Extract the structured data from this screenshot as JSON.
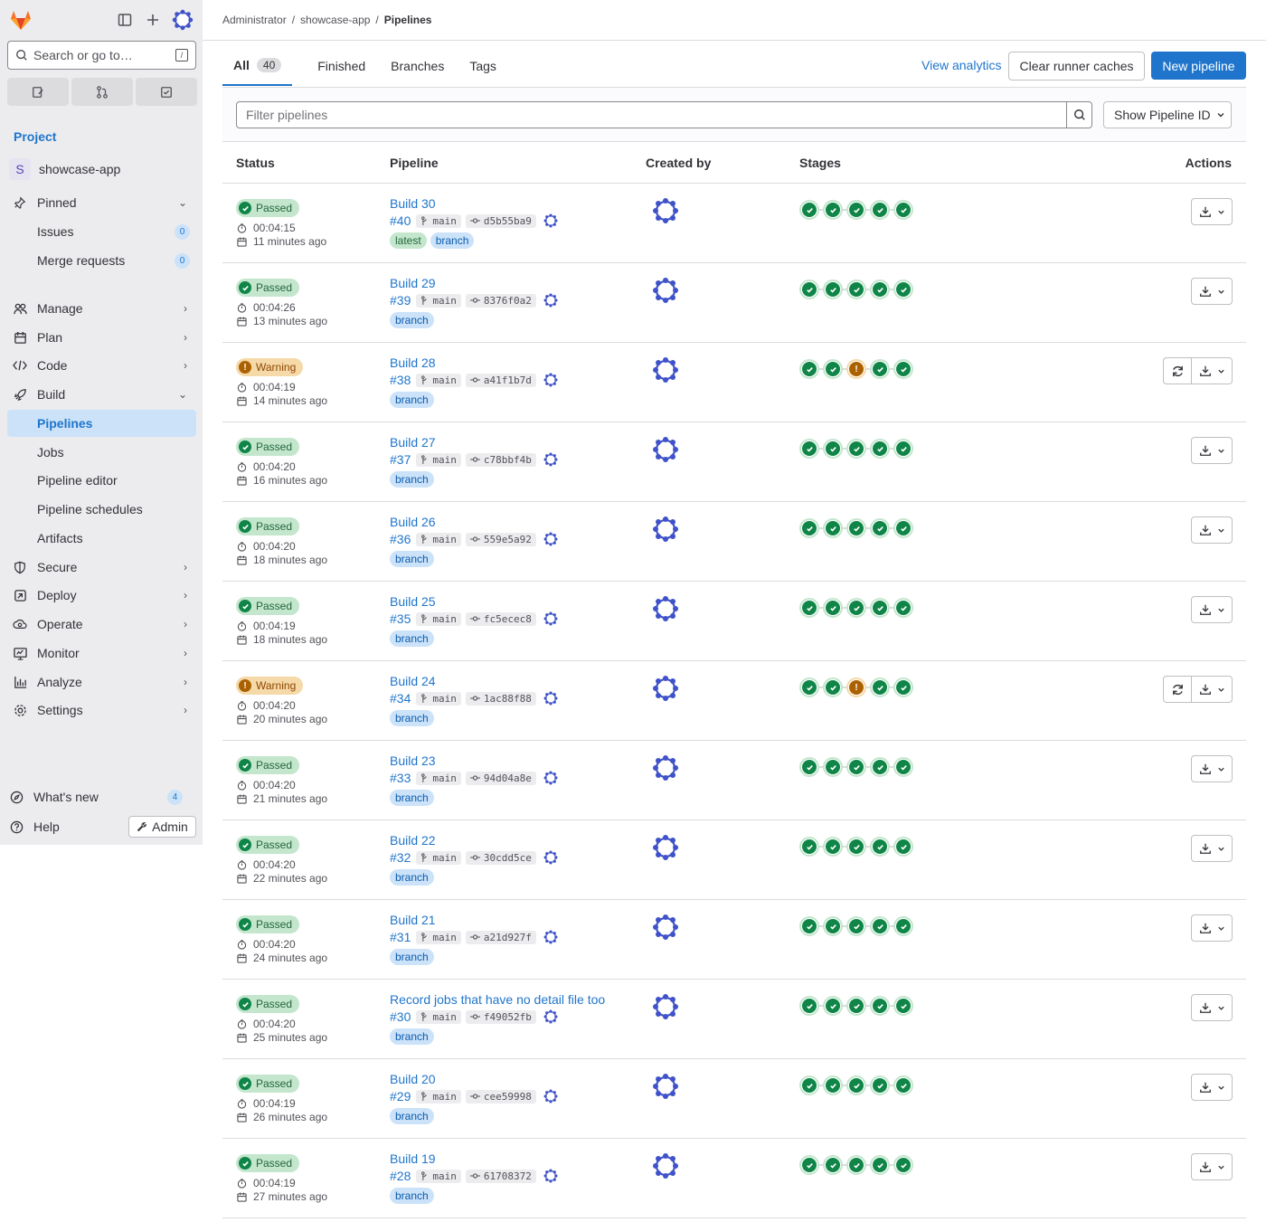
{
  "sidebar": {
    "search_placeholder": "Search or go to…",
    "search_shortcut": "/",
    "section_label": "Project",
    "project": {
      "avatar_letter": "S",
      "name": "showcase-app"
    },
    "pinned": {
      "label": "Pinned",
      "items": [
        {
          "label": "Issues",
          "count": "0"
        },
        {
          "label": "Merge requests",
          "count": "0"
        }
      ]
    },
    "nav": [
      {
        "label": "Manage",
        "icon": "manage-icon"
      },
      {
        "label": "Plan",
        "icon": "plan-icon"
      },
      {
        "label": "Code",
        "icon": "code-icon"
      },
      {
        "label": "Build",
        "icon": "rocket-icon",
        "expanded": true
      }
    ],
    "build_items": [
      {
        "label": "Pipelines",
        "active": true
      },
      {
        "label": "Jobs"
      },
      {
        "label": "Pipeline editor"
      },
      {
        "label": "Pipeline schedules"
      },
      {
        "label": "Artifacts"
      }
    ],
    "nav2": [
      {
        "label": "Secure",
        "icon": "shield-icon"
      },
      {
        "label": "Deploy",
        "icon": "deploy-icon"
      },
      {
        "label": "Operate",
        "icon": "cloud-icon"
      },
      {
        "label": "Monitor",
        "icon": "monitor-icon"
      },
      {
        "label": "Analyze",
        "icon": "chart-icon"
      },
      {
        "label": "Settings",
        "icon": "gear-icon"
      }
    ],
    "whats_new": {
      "label": "What's new",
      "count": "4"
    },
    "help_label": "Help",
    "admin_label": "Admin"
  },
  "breadcrumb": [
    "Administrator",
    "showcase-app",
    "Pipelines"
  ],
  "tabs": [
    {
      "label": "All",
      "count": "40",
      "active": true
    },
    {
      "label": "Finished"
    },
    {
      "label": "Branches"
    },
    {
      "label": "Tags"
    }
  ],
  "header_actions": {
    "view_analytics": "View analytics",
    "clear_caches": "Clear runner caches",
    "new_pipeline": "New pipeline"
  },
  "filter": {
    "placeholder": "Filter pipelines",
    "show_id": "Show Pipeline ID"
  },
  "columns": [
    "Status",
    "Pipeline",
    "Created by",
    "Stages",
    "Actions"
  ],
  "colors": {
    "accent": "#1f75cb",
    "success": "#108548",
    "warning": "#ab6100"
  },
  "pipelines": [
    {
      "status": "Passed",
      "status_type": "success",
      "duration": "00:04:15",
      "finished": "11 minutes ago",
      "name": "Build 30",
      "id": "#40",
      "ref": "main",
      "sha": "d5b55ba9",
      "tags": [
        "latest",
        "branch"
      ],
      "stages": [
        "success",
        "success",
        "success",
        "success",
        "success"
      ],
      "retry": false
    },
    {
      "status": "Passed",
      "status_type": "success",
      "duration": "00:04:26",
      "finished": "13 minutes ago",
      "name": "Build 29",
      "id": "#39",
      "ref": "main",
      "sha": "8376f0a2",
      "tags": [
        "branch"
      ],
      "stages": [
        "success",
        "success",
        "success",
        "success",
        "success"
      ],
      "retry": false
    },
    {
      "status": "Warning",
      "status_type": "warning",
      "duration": "00:04:19",
      "finished": "14 minutes ago",
      "name": "Build 28",
      "id": "#38",
      "ref": "main",
      "sha": "a41f1b7d",
      "tags": [
        "branch"
      ],
      "stages": [
        "success",
        "success",
        "warning",
        "success",
        "success"
      ],
      "retry": true
    },
    {
      "status": "Passed",
      "status_type": "success",
      "duration": "00:04:20",
      "finished": "16 minutes ago",
      "name": "Build 27",
      "id": "#37",
      "ref": "main",
      "sha": "c78bbf4b",
      "tags": [
        "branch"
      ],
      "stages": [
        "success",
        "success",
        "success",
        "success",
        "success"
      ],
      "retry": false
    },
    {
      "status": "Passed",
      "status_type": "success",
      "duration": "00:04:20",
      "finished": "18 minutes ago",
      "name": "Build 26",
      "id": "#36",
      "ref": "main",
      "sha": "559e5a92",
      "tags": [
        "branch"
      ],
      "stages": [
        "success",
        "success",
        "success",
        "success",
        "success"
      ],
      "retry": false
    },
    {
      "status": "Passed",
      "status_type": "success",
      "duration": "00:04:19",
      "finished": "18 minutes ago",
      "name": "Build 25",
      "id": "#35",
      "ref": "main",
      "sha": "fc5ecec8",
      "tags": [
        "branch"
      ],
      "stages": [
        "success",
        "success",
        "success",
        "success",
        "success"
      ],
      "retry": false
    },
    {
      "status": "Warning",
      "status_type": "warning",
      "duration": "00:04:20",
      "finished": "20 minutes ago",
      "name": "Build 24",
      "id": "#34",
      "ref": "main",
      "sha": "1ac88f88",
      "tags": [
        "branch"
      ],
      "stages": [
        "success",
        "success",
        "warning",
        "success",
        "success"
      ],
      "retry": true
    },
    {
      "status": "Passed",
      "status_type": "success",
      "duration": "00:04:20",
      "finished": "21 minutes ago",
      "name": "Build 23",
      "id": "#33",
      "ref": "main",
      "sha": "94d04a8e",
      "tags": [
        "branch"
      ],
      "stages": [
        "success",
        "success",
        "success",
        "success",
        "success"
      ],
      "retry": false
    },
    {
      "status": "Passed",
      "status_type": "success",
      "duration": "00:04:20",
      "finished": "22 minutes ago",
      "name": "Build 22",
      "id": "#32",
      "ref": "main",
      "sha": "30cdd5ce",
      "tags": [
        "branch"
      ],
      "stages": [
        "success",
        "success",
        "success",
        "success",
        "success"
      ],
      "retry": false
    },
    {
      "status": "Passed",
      "status_type": "success",
      "duration": "00:04:20",
      "finished": "24 minutes ago",
      "name": "Build 21",
      "id": "#31",
      "ref": "main",
      "sha": "a21d927f",
      "tags": [
        "branch"
      ],
      "stages": [
        "success",
        "success",
        "success",
        "success",
        "success"
      ],
      "retry": false
    },
    {
      "status": "Passed",
      "status_type": "success",
      "duration": "00:04:20",
      "finished": "25 minutes ago",
      "name": "Record jobs that have no detail file too",
      "id": "#30",
      "ref": "main",
      "sha": "f49052fb",
      "tags": [
        "branch"
      ],
      "stages": [
        "success",
        "success",
        "success",
        "success",
        "success"
      ],
      "retry": false
    },
    {
      "status": "Passed",
      "status_type": "success",
      "duration": "00:04:19",
      "finished": "26 minutes ago",
      "name": "Build 20",
      "id": "#29",
      "ref": "main",
      "sha": "cee59998",
      "tags": [
        "branch"
      ],
      "stages": [
        "success",
        "success",
        "success",
        "success",
        "success"
      ],
      "retry": false
    },
    {
      "status": "Passed",
      "status_type": "success",
      "duration": "00:04:19",
      "finished": "27 minutes ago",
      "name": "Build 19",
      "id": "#28",
      "ref": "main",
      "sha": "61708372",
      "tags": [
        "branch"
      ],
      "stages": [
        "success",
        "success",
        "success",
        "success",
        "success"
      ],
      "retry": false
    }
  ]
}
